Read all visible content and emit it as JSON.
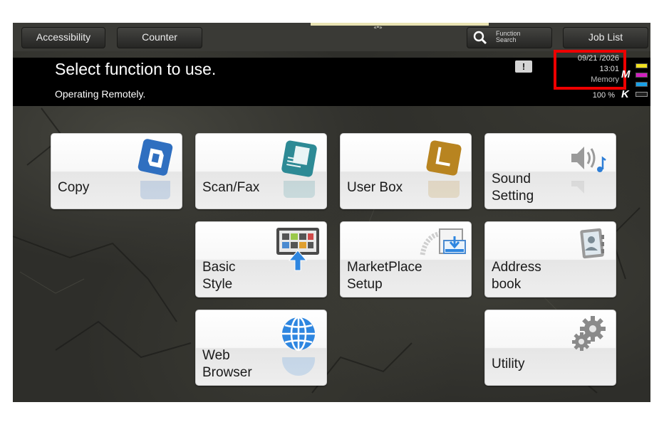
{
  "top_tabs": {
    "accessibility": "Accessibility",
    "counter": "Counter",
    "function_search_line1": "Function",
    "function_search_line2": "Search",
    "job_list": "Job List"
  },
  "header": {
    "title": "Select function to use.",
    "subtitle": "Operating Remotely.",
    "info_icon": "!",
    "date": "09/21 /2026",
    "time": "13:01",
    "memory_label": "Memory",
    "memory_percent": "100 %"
  },
  "toner": {
    "letter_m": "M",
    "letter_k": "K",
    "colors": {
      "yellow": "#f0e020",
      "magenta": "#d020c0",
      "cyan": "#1aa0e6",
      "black": "#202020"
    }
  },
  "tiles": {
    "copy": {
      "label": "Copy",
      "icon": "copy-icon"
    },
    "scan_fax": {
      "label": "Scan/Fax",
      "icon": "scan-fax-icon"
    },
    "user_box": {
      "label": "User Box",
      "icon": "user-box-icon"
    },
    "sound_setting": {
      "line1": "Sound",
      "line2": "Setting",
      "icon": "speaker-icon"
    },
    "basic_style": {
      "line1": "Basic",
      "line2": "Style",
      "icon": "basic-style-icon"
    },
    "marketplace_setup": {
      "line1": "MarketPlace",
      "line2": "Setup",
      "icon": "marketplace-icon"
    },
    "address_book": {
      "line1": "Address",
      "line2": "book",
      "icon": "address-book-icon"
    },
    "web_browser": {
      "line1": "Web",
      "line2": "Browser",
      "icon": "globe-icon"
    },
    "utility": {
      "label": "Utility",
      "icon": "gear-icon"
    }
  },
  "highlight_color": "#ee0000"
}
